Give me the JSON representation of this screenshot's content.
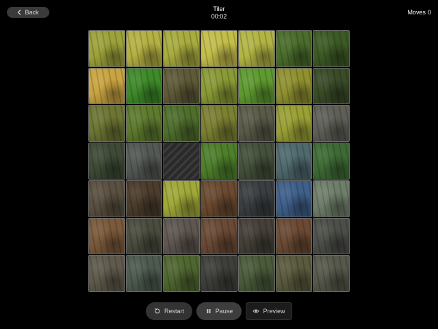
{
  "header": {
    "back_label": "Back",
    "title": "Tiler",
    "timer": "00:02",
    "moves_label": "Moves",
    "moves_count": "0"
  },
  "board": {
    "rows": 7,
    "cols": 7,
    "empty_index": 23,
    "tile_colors": [
      "#9da23a",
      "#b5b043",
      "#a8ab3e",
      "#c3bd4a",
      "#b2b444",
      "#4a6d2b",
      "#3c5a25",
      "#c9a442",
      "#3e8a2a",
      "#5e5a38",
      "#8a9a35",
      "#5f9a30",
      "#8f9130",
      "#3a4b28",
      "#6d7534",
      "#5d7a2e",
      "#4f6e2c",
      "#7b8032",
      "#5a5a48",
      "#9aa034",
      "#5f5f58",
      "#3e4a36",
      "#545854",
      "#2e2e2e",
      "#4e7f2b",
      "#44503a",
      "#4f6a6e",
      "#3e6b35",
      "#5a5040",
      "#4b3c2c",
      "#a0a838",
      "#6a4a30",
      "#3a3e40",
      "#3f5f8a",
      "#6f7e6a",
      "#7a5a3a",
      "#4a4c3e",
      "#5f5650",
      "#6a4a35",
      "#444038",
      "#6b4a34",
      "#4c4e48",
      "#5f5a4c",
      "#4e5a50",
      "#4f6630",
      "#3e3e3a",
      "#4a5a3a",
      "#5a5a3e",
      "#55584a"
    ]
  },
  "controls": {
    "restart_label": "Restart",
    "pause_label": "Pause",
    "preview_label": "Preview"
  }
}
